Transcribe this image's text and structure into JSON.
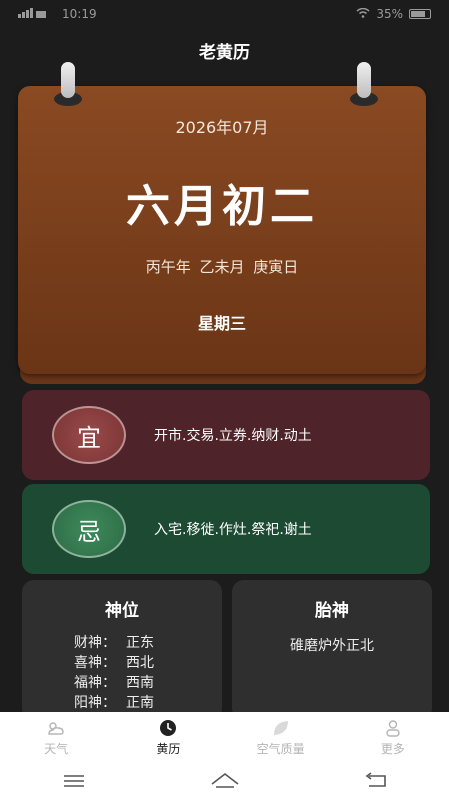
{
  "status_bar": {
    "time": "10:19",
    "battery": "35%"
  },
  "app": {
    "title": "老黄历"
  },
  "calendar": {
    "year_month": "2026年07月",
    "lunar_date": "六月初二",
    "ganzhi": "丙午年  乙未月  庚寅日",
    "weekday": "星期三"
  },
  "yi": {
    "badge": "宜",
    "text": "开市.交易.立券.纳财.动土"
  },
  "ji": {
    "badge": "忌",
    "text": "入宅.移徙.作灶.祭祀.谢土"
  },
  "shenwei": {
    "title": "神位",
    "rows": [
      {
        "key": "财神：",
        "value": "正东"
      },
      {
        "key": "喜神：",
        "value": "西北"
      },
      {
        "key": "福神：",
        "value": "西南"
      },
      {
        "key": "阳神：",
        "value": "正南"
      }
    ]
  },
  "taishen": {
    "title": "胎神",
    "text": "碓磨炉外正北"
  },
  "bottom_nav": {
    "items": [
      {
        "label": "天气",
        "icon": "weather-icon"
      },
      {
        "label": "黄历",
        "icon": "clock-icon"
      },
      {
        "label": "空气质量",
        "icon": "leaf-icon"
      },
      {
        "label": "更多",
        "icon": "person-icon"
      }
    ],
    "active_index": 1
  },
  "colors": {
    "background": "#1c1c1c",
    "calendar_card": "#7a3f1c",
    "yi_panel": "#4e2329",
    "ji_panel": "#1c4a33",
    "god_card": "#2f2f2f"
  }
}
